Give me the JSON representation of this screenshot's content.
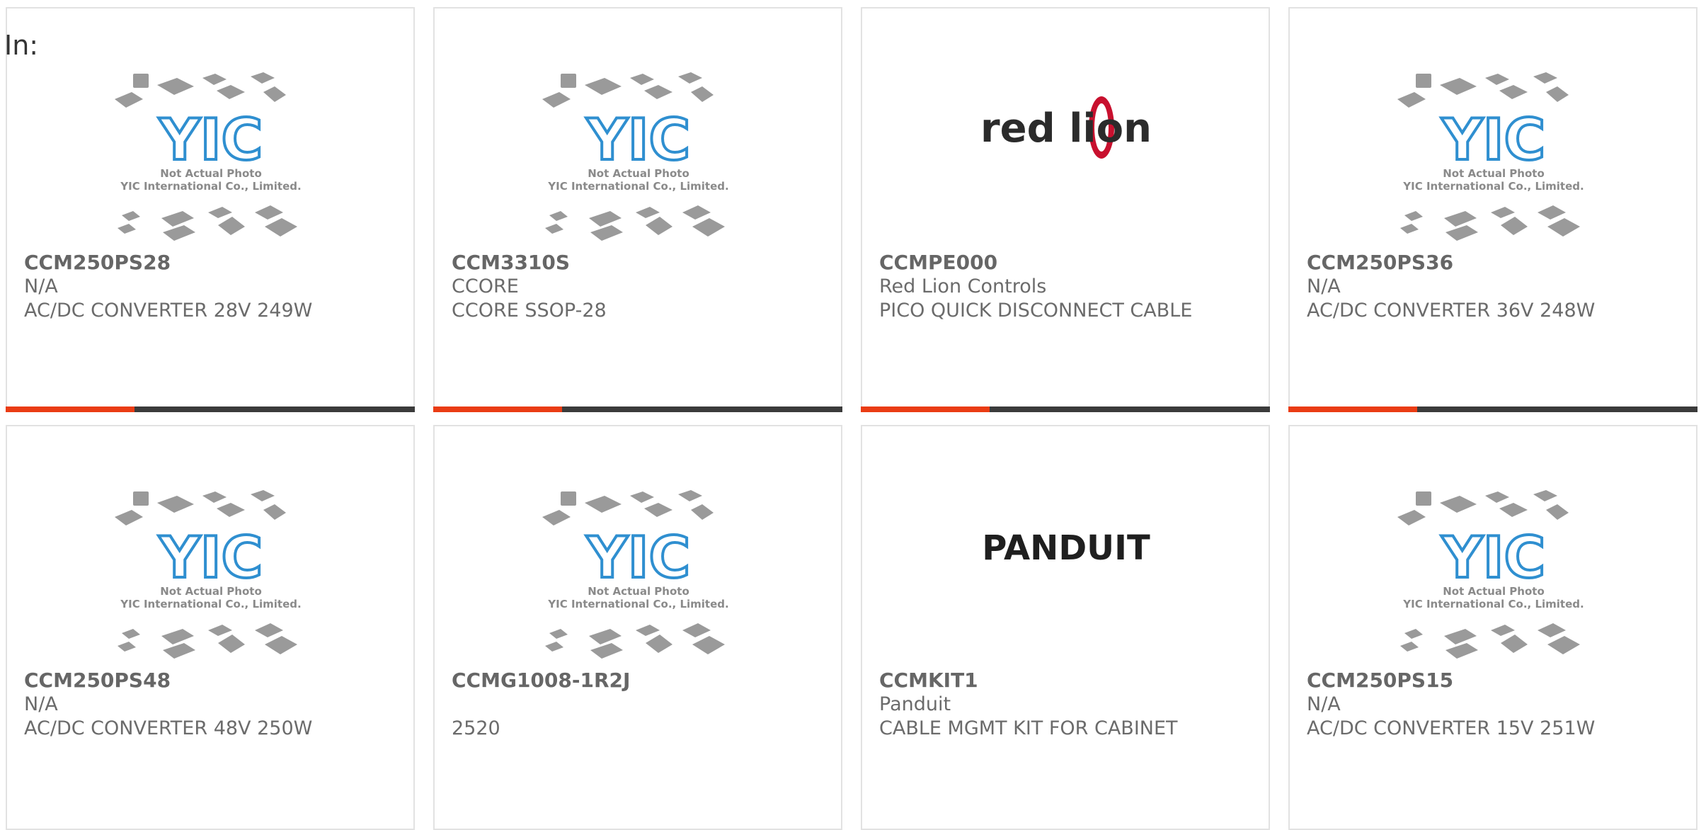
{
  "header": {
    "label": "In:"
  },
  "products": [
    {
      "part_number": "CCM250PS28",
      "manufacturer": "N/A",
      "description": "AC/DC CONVERTER 28V 249W",
      "image_type": "placeholder-chip-photo",
      "image_caption_line1": "Not Actual Photo",
      "image_caption_line2": "YIC International Co., Limited.",
      "image_logo_text": "YIC"
    },
    {
      "part_number": "CCM3310S",
      "manufacturer": "CCORE",
      "description": "CCORE SSOP-28",
      "image_type": "placeholder-chip-photo",
      "image_caption_line1": "Not Actual Photo",
      "image_caption_line2": "YIC International Co., Limited.",
      "image_logo_text": "YIC"
    },
    {
      "part_number": "CCMPE000",
      "manufacturer": "Red Lion Controls",
      "description": "PICO QUICK DISCONNECT CABLE",
      "image_type": "brand-logo",
      "image_logo_text": "red lion"
    },
    {
      "part_number": "CCM250PS36",
      "manufacturer": "N/A",
      "description": "AC/DC CONVERTER 36V 248W",
      "image_type": "placeholder-chip-photo",
      "image_caption_line1": "Not Actual Photo",
      "image_caption_line2": "YIC International Co., Limited.",
      "image_logo_text": "YIC"
    },
    {
      "part_number": "CCM250PS48",
      "manufacturer": "N/A",
      "description": "AC/DC CONVERTER 48V 250W",
      "image_type": "placeholder-chip-photo",
      "image_caption_line1": "Not Actual Photo",
      "image_caption_line2": "YIC International Co., Limited.",
      "image_logo_text": "YIC"
    },
    {
      "part_number": "CCMG1008-1R2J",
      "manufacturer": "",
      "description": "2520",
      "image_type": "placeholder-chip-photo",
      "image_caption_line1": "Not Actual Photo",
      "image_caption_line2": "YIC International Co., Limited.",
      "image_logo_text": "YIC"
    },
    {
      "part_number": "CCMKIT1",
      "manufacturer": "Panduit",
      "description": "CABLE MGMT KIT FOR CABINET",
      "image_type": "brand-logo",
      "image_logo_text": "PANDUIT"
    },
    {
      "part_number": "CCM250PS15",
      "manufacturer": "N/A",
      "description": "AC/DC CONVERTER 15V 251W",
      "image_type": "placeholder-chip-photo",
      "image_caption_line1": "Not Actual Photo",
      "image_caption_line2": "YIC International Co., Limited.",
      "image_logo_text": "YIC"
    }
  ],
  "colors": {
    "accent": "#ea3c14",
    "bar_dark": "#3b3b3b",
    "card_border": "#e2e2e2",
    "text_gray": "#6b6b6b",
    "logo_blue": "#2f8fd0",
    "red_lion_red": "#c8102e"
  }
}
